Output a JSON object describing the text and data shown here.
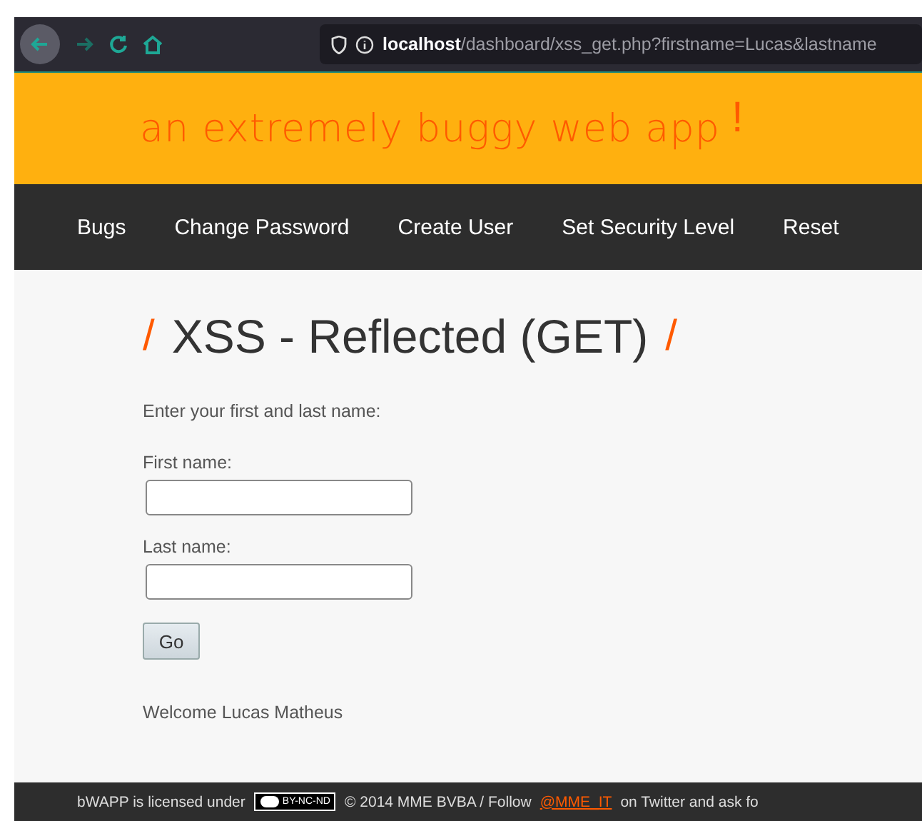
{
  "browser": {
    "url": "**localhost**/dashboard/xss_get.php?firstname=Lucas&lastname"
  },
  "header": {
    "tagline": "an extremely buggy web app",
    "mark": "!"
  },
  "nav": {
    "items": [
      {
        "label": "Bugs"
      },
      {
        "label": "Change Password"
      },
      {
        "label": "Create User"
      },
      {
        "label": "Set Security Level"
      },
      {
        "label": "Reset"
      }
    ]
  },
  "page": {
    "title": "XSS - Reflected (GET)",
    "slash": "/",
    "intro": "Enter your first and last name:",
    "fields": [
      {
        "label": "First name:"
      },
      {
        "label": "Last name:"
      }
    ],
    "button": "Go",
    "welcome": "Welcome Lucas Matheus"
  },
  "footer": {
    "text_before": "bWAPP is licensed under",
    "badge": "BY-NC-ND",
    "text_middle": "© 2014 MME BVBA / Follow",
    "link": "@MME_IT",
    "text_after": "on Twitter and ask fo"
  }
}
